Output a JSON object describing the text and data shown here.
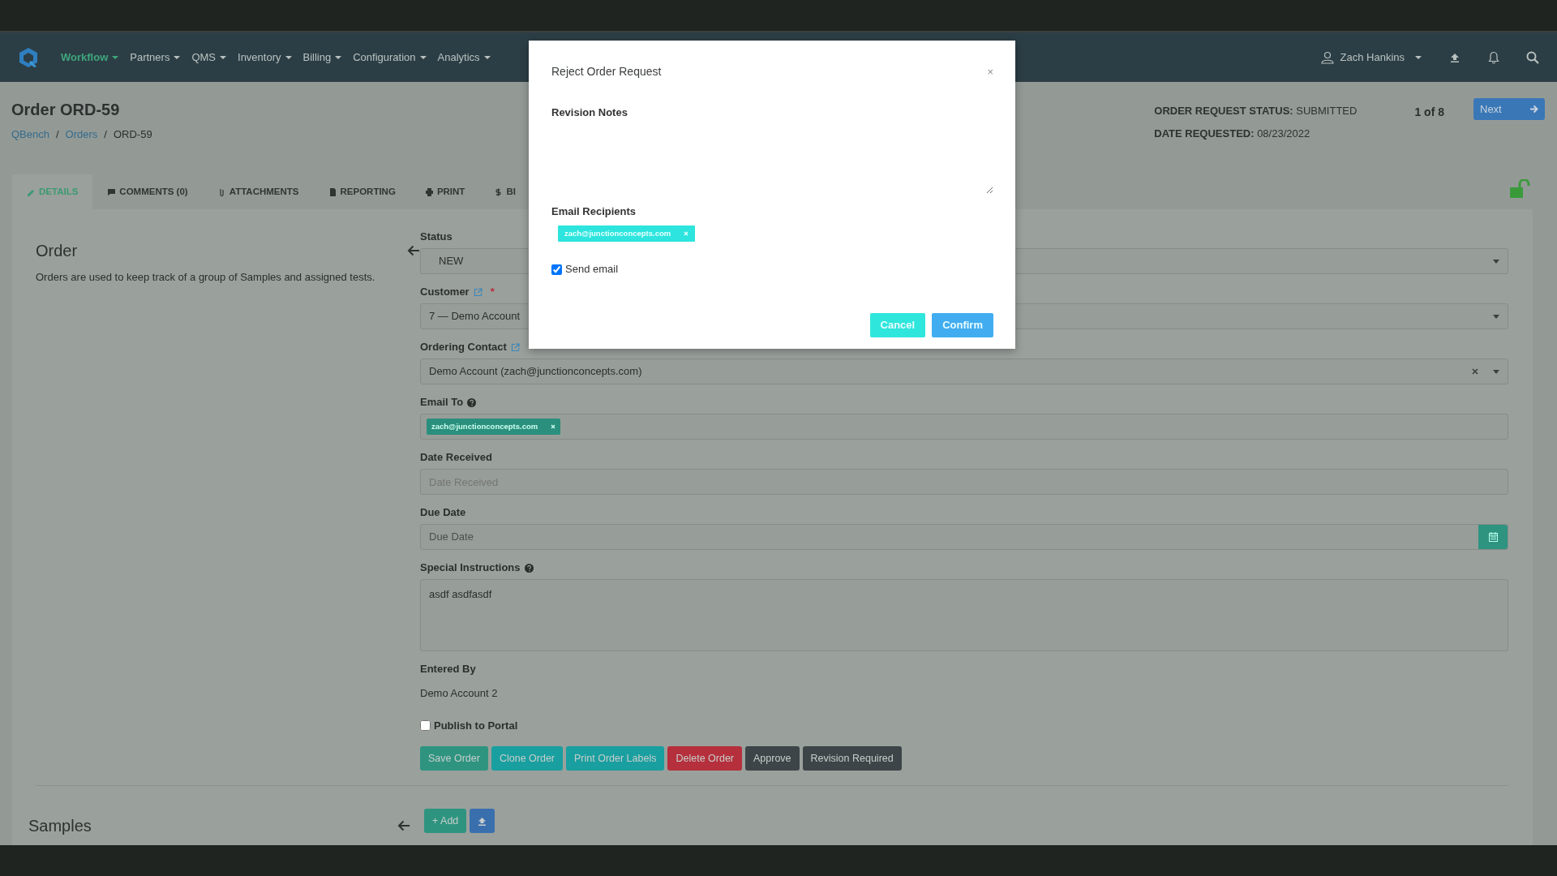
{
  "nav": {
    "items": [
      {
        "label": "Workflow",
        "selected": true
      },
      {
        "label": "Partners",
        "selected": false
      },
      {
        "label": "QMS",
        "selected": false
      },
      {
        "label": "Inventory",
        "selected": false
      },
      {
        "label": "Billing",
        "selected": false
      },
      {
        "label": "Configuration",
        "selected": false
      },
      {
        "label": "Analytics",
        "selected": false
      }
    ],
    "user": "Zach Hankins"
  },
  "header": {
    "title": "Order ORD-59",
    "breadcrumb": [
      "QBench",
      "Orders",
      "ORD-59"
    ],
    "separator": "/",
    "status_label": "ORDER REQUEST STATUS:",
    "status_value": "SUBMITTED",
    "date_label": "DATE REQUESTED:",
    "date_value": "08/23/2022",
    "pager": "1 of 8",
    "next": "Next",
    "locked": false
  },
  "tabs": [
    {
      "label": "DETAILS",
      "selected": true
    },
    {
      "label": "COMMENTS (0)",
      "selected": false
    },
    {
      "label": "ATTACHMENTS",
      "selected": false
    },
    {
      "label": "REPORTING",
      "selected": false
    },
    {
      "label": "PRINT",
      "selected": false
    },
    {
      "label": "BI",
      "selected": false
    }
  ],
  "section": {
    "title": "Order",
    "description": "Orders are used to keep track of a group of Samples and assigned tests."
  },
  "fields": [
    {
      "kind": "select",
      "label": "Status",
      "value": "NEW"
    },
    {
      "kind": "select",
      "label": "Customer",
      "value": "7 — Demo Account",
      "link": true,
      "required_mark": "*"
    },
    {
      "kind": "select",
      "label": "Ordering Contact",
      "value": "Demo Account (zach@junctionconcepts.com)",
      "link": true,
      "clearable": true
    },
    {
      "kind": "tags",
      "label": "Email To",
      "help": true,
      "tags": [
        "zach@junctionconcepts.com"
      ]
    },
    {
      "kind": "input",
      "label": "Date Received",
      "placeholder": "Date Received"
    },
    {
      "kind": "date",
      "label": "Due Date",
      "placeholder": "Due Date"
    },
    {
      "kind": "textarea",
      "label": "Special Instructions",
      "help": true,
      "value": "asdf asdfasdf"
    },
    {
      "kind": "static",
      "label": "Entered By",
      "value": "Demo Account 2"
    }
  ],
  "publish": {
    "label": "Publish to Portal",
    "checked": false
  },
  "actions": [
    {
      "label": "Save Order",
      "color": "#2e9480"
    },
    {
      "label": "Clone Order",
      "color": "#1a9fa0"
    },
    {
      "label": "Print Order Labels",
      "color": "#1a9fa0"
    },
    {
      "label": "Delete Order",
      "color": "#b5303c"
    },
    {
      "label": "Approve",
      "color": "#3d4548"
    },
    {
      "label": "Revision Required",
      "color": "#3d4548"
    }
  ],
  "samples": {
    "title": "Samples",
    "add": "+ Add"
  },
  "modal": {
    "title": "Reject Order Request",
    "close": "×",
    "notes_label": "Revision Notes",
    "recipients_label": "Email Recipients",
    "recipients": [
      "zach@junctionconcepts.com"
    ],
    "send_email": {
      "label": "Send email",
      "checked": true
    },
    "buttons": [
      {
        "label": "Cancel",
        "color": "#2fe6dc"
      },
      {
        "label": "Confirm",
        "color": "#41adf0"
      }
    ]
  }
}
